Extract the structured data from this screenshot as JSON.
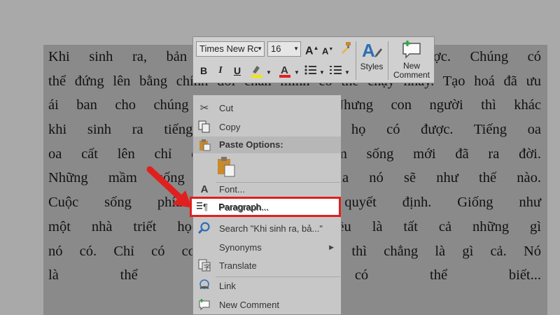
{
  "document": {
    "lines": [
      "Khi sinh ra, bản năng của con người đã được. Chúng có",
      "thể đứng lên bằng chính đôi chân mình có thể chạy nhảy. Tạo hoá đã ưu",
      "ái ban cho chúng những thứ đó. Nhưng con người thì khác",
      "khi sinh ra tiếng khóc những gì họ có được. Tiếng oa",
      "oa cất lên chỉ đơn giản một mầm sống mới đã ra đời.",
      "Những mầm sống đó tương lai của nó sẽ như thế nào.",
      "Cuộc sống phía trước do nó quyết định. Giống như",
      "một nhà triết học đã sinh ra đều là tất cả những gì",
      "nó có. Chỉ có con người một lòng thì chẳng là gì cả. Nó",
      "là thể thì vật có thể biết..."
    ]
  },
  "toolbar": {
    "font_name": "Times New Rc",
    "font_size": "16",
    "grow_font": "A",
    "shrink_font": "A",
    "bold": "B",
    "italic": "I",
    "underline": "U",
    "styles_label": "Styles",
    "new_comment_line1": "New",
    "new_comment_line2": "Comment"
  },
  "context_menu": {
    "cut": "Cut",
    "copy": "Copy",
    "paste_options": "Paste Options:",
    "font": "Font...",
    "paragraph": "Paragraph...",
    "search": "Search \"Khi sinh ra, bả...\"",
    "synonyms": "Synonyms",
    "translate": "Translate",
    "link": "Link",
    "new_comment": "New Comment"
  },
  "colors": {
    "highlight_border": "#e0201f",
    "arrow": "#e0201f",
    "font_color_bar": "#e0201f",
    "highlighter_bar": "#f2e600"
  },
  "icons": {
    "cut": "scissors-icon",
    "copy": "copy-icon",
    "paste": "clipboard-icon",
    "font": "font-icon",
    "paragraph": "paragraph-icon",
    "search": "search-icon",
    "translate": "translate-icon",
    "link": "link-icon",
    "new_comment": "comment-icon"
  }
}
